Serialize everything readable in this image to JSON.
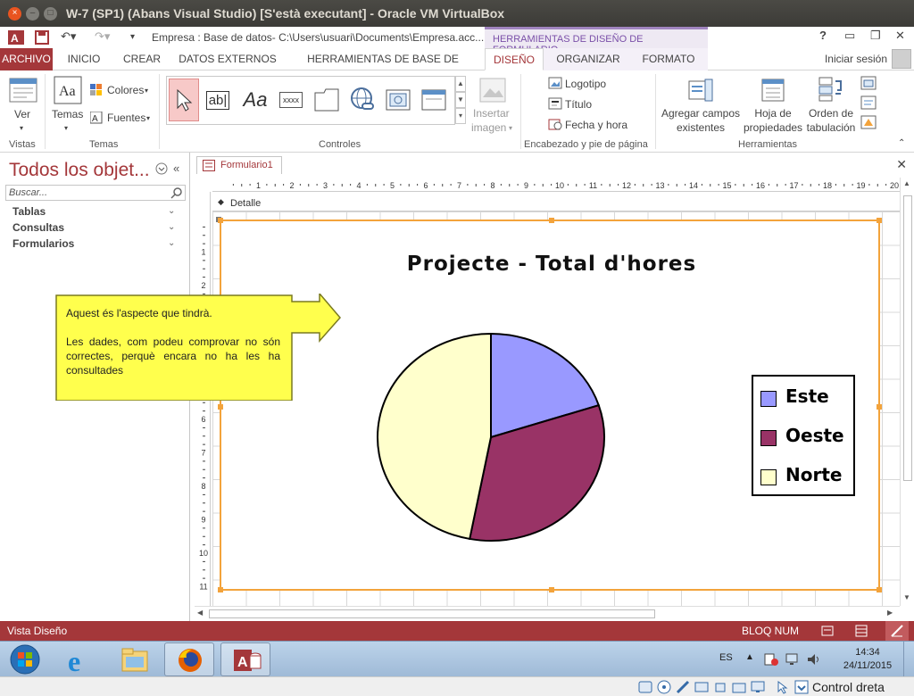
{
  "vbox": {
    "title": "W-7 (SP1) (Abans Visual Studio) [S'està executant] - Oracle VM VirtualBox",
    "host_key": "Control dreta"
  },
  "qat": {
    "path": "Empresa : Base de datos- C:\\Users\\usuari\\Documents\\Empresa.acc...",
    "context_header": "HERRAMIENTAS DE DISEÑO DE FORMULARIO",
    "help": "?"
  },
  "tabs": {
    "archivo": "ARCHIVO",
    "inicio": "INICIO",
    "crear": "CREAR",
    "datos_externos": "DATOS EXTERNOS",
    "herramientas_bd": "HERRAMIENTAS DE BASE DE DATOS",
    "diseno": "DISEÑO",
    "organizar": "ORGANIZAR",
    "formato": "FORMATO",
    "signin": "Iniciar sesión"
  },
  "ribbon": {
    "ver": "Ver",
    "temas": "Temas",
    "colores": "Colores",
    "fuentes": "Fuentes",
    "insertar_imagen": [
      "Insertar",
      "imagen"
    ],
    "logotipo": "Logotipo",
    "titulo": "Título",
    "fecha_hora": "Fecha y hora",
    "agregar_campos": [
      "Agregar campos",
      "existentes"
    ],
    "hoja_propiedades": [
      "Hoja de",
      "propiedades"
    ],
    "orden_tabulacion": [
      "Orden de",
      "tabulación"
    ],
    "groups": {
      "vistas": "Vistas",
      "temas": "Temas",
      "controles": "Controles",
      "encabezado": "Encabezado y pie de página",
      "herramientas": "Herramientas"
    },
    "text_box_glyph": "ab|",
    "label_glyph": "Aa",
    "xxxx": "xxxx"
  },
  "nav": {
    "title": "Todos los objet...",
    "search_placeholder": "Buscar...",
    "items": [
      "Tablas",
      "Consultas",
      "Formularios"
    ]
  },
  "doc": {
    "tab": "Formulario1",
    "section": "Detalle",
    "ruler_h": [
      "1",
      "2",
      "3",
      "4",
      "5",
      "6",
      "7",
      "8",
      "9",
      "10",
      "11",
      "12",
      "13",
      "14",
      "15",
      "16",
      "17",
      "18",
      "19",
      "20"
    ],
    "ruler_v": [
      "1",
      "2",
      "3",
      "4",
      "5",
      "6",
      "7",
      "8",
      "9",
      "10",
      "11"
    ]
  },
  "callout": {
    "line1": "Aquest és l'aspecte que tindrà.",
    "line2": "Les dades, com podeu comprovar no són correctes, perquè encara no ha les ha consultades"
  },
  "chart_data": {
    "type": "pie",
    "title": "Projecte - Total d'hores",
    "categories": [
      "Este",
      "Oeste",
      "Norte"
    ],
    "values": [
      20,
      33,
      47
    ],
    "colors": [
      "#9999ff",
      "#993366",
      "#ffffcc"
    ],
    "legend": "right"
  },
  "status": {
    "mode": "Vista Diseño",
    "bloq_num": "BLOQ NUM"
  },
  "taskbar": {
    "lang": "ES",
    "time": "14:34",
    "date": "24/11/2015"
  }
}
